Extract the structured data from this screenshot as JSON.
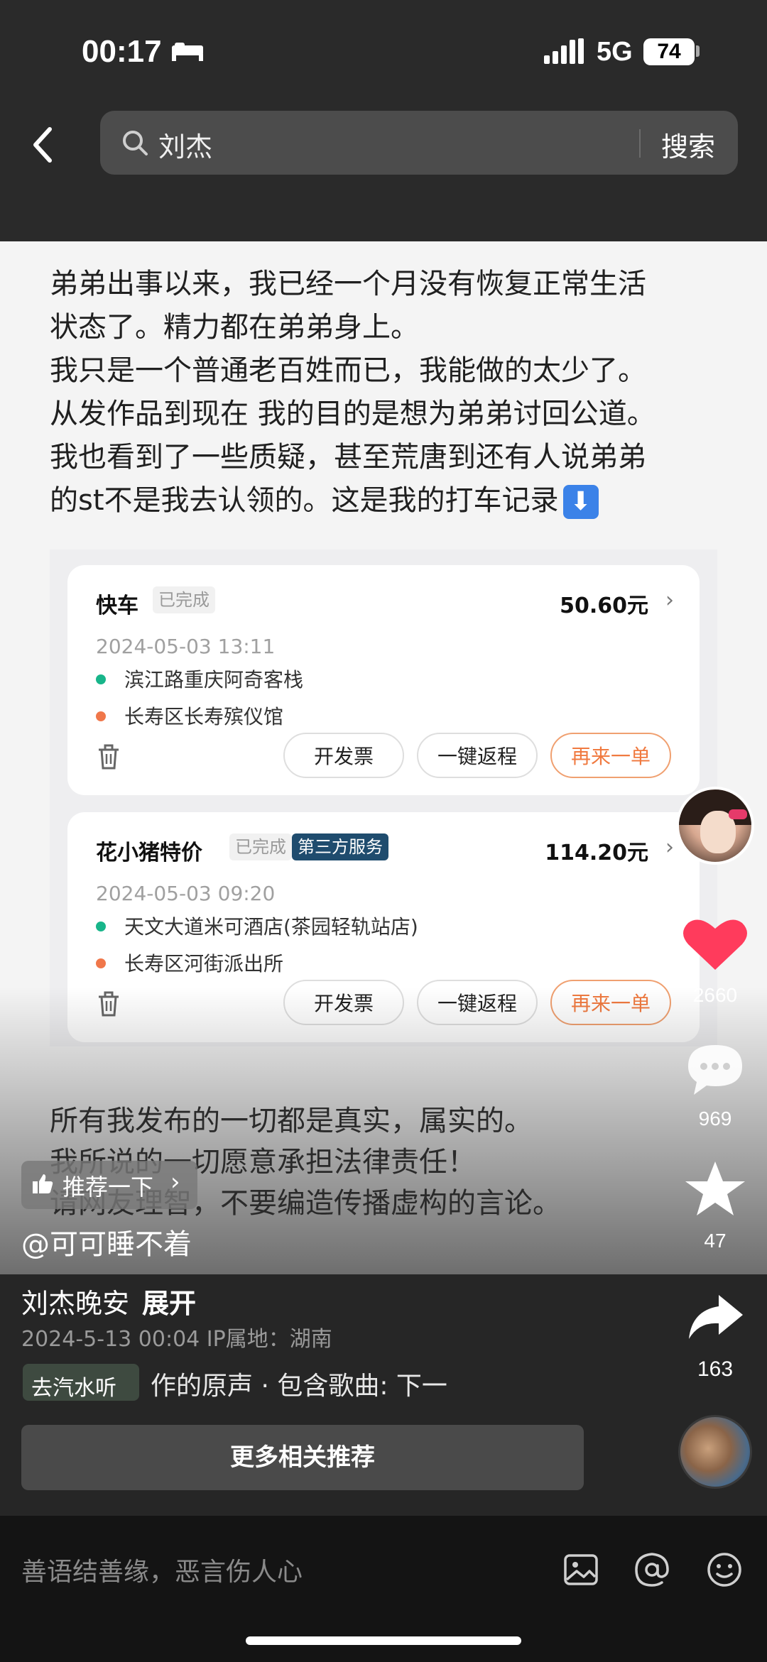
{
  "status_bar": {
    "time": "00:17",
    "network": "5G",
    "battery": "74"
  },
  "search": {
    "query": "刘杰",
    "button": "搜索"
  },
  "post": {
    "lines": [
      "弟弟出事以来，我已经一个月没有恢复正常生活",
      "状态了。精力都在弟弟身上。",
      "我只是一个普通老百姓而已，我能做的太少了。",
      "从发作品到现在 我的目的是想为弟弟讨回公道。",
      "我也看到了一些质疑，甚至荒唐到还有人说弟弟",
      "的st不是我去认领的。这是我的打车记录"
    ],
    "arrow": "⬇",
    "lines2": [
      "所有我发布的一切都是真实，属实的。",
      "我所说的一切愿意承担法律责任！",
      "请网友理智，不要编造传播虚构的言论。"
    ]
  },
  "trips": [
    {
      "title": "快车",
      "status": "已完成",
      "extra_tag": "",
      "price": "50.60元",
      "date": "2024-05-03 13:11",
      "from": "滨江路重庆阿奇客栈",
      "to": "长寿区长寿殡仪馆",
      "buttons": [
        "开发票",
        "一键返程",
        "再来一单"
      ]
    },
    {
      "title": "花小猪特价",
      "status": "已完成",
      "extra_tag": "第三方服务",
      "price": "114.20元",
      "date": "2024-05-03 09:20",
      "from": "天文大道米可酒店(茶园轻轨站店)",
      "to": "长寿区河街派出所",
      "buttons": [
        "开发票",
        "一键返程",
        "再来一单"
      ]
    }
  ],
  "recommend_chip": "推荐一下",
  "author": "@可可睡不着",
  "rail": {
    "likes": "2660",
    "comments": "969",
    "favorites": "47",
    "shares": "163"
  },
  "caption": {
    "title": "刘杰晚安",
    "expand": "展开",
    "meta": "2024-5-13 00:04  IP属地：湖南",
    "music_chip": "去汽水听",
    "music_text": "作的原声 · 包含歌曲: 下一",
    "more_button": "更多相关推荐"
  },
  "comment": {
    "placeholder": "善语结善缘，恶言伤人心"
  },
  "colors": {
    "like_red": "#ff3b5c",
    "route_green": "#18b58a",
    "route_orange": "#f0774a",
    "third_party_tag": "#1f4c6e"
  }
}
